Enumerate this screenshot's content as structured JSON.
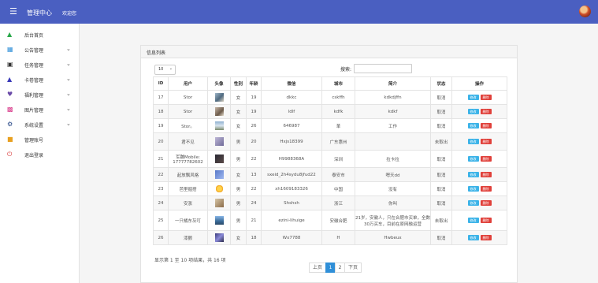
{
  "header": {
    "app_title": "管理中心",
    "welcome": "欢迎您"
  },
  "sidebar": {
    "items": [
      {
        "label": "后台首页",
        "icon": "home-icon",
        "expandable": false
      },
      {
        "label": "公告管理",
        "icon": "notice-icon",
        "expandable": true
      },
      {
        "label": "任务管理",
        "icon": "task-icon",
        "expandable": true
      },
      {
        "label": "卡卷管理",
        "icon": "card-icon",
        "expandable": true
      },
      {
        "label": "福利管理",
        "icon": "heart-icon",
        "expandable": true
      },
      {
        "label": "图片管理",
        "icon": "image-icon",
        "expandable": true
      },
      {
        "label": "系统设置",
        "icon": "gear-icon",
        "expandable": true
      },
      {
        "label": "管理账号",
        "icon": "account-icon",
        "expandable": false
      },
      {
        "label": "退出登录",
        "icon": "power-icon",
        "expandable": false
      }
    ]
  },
  "panel": {
    "title": "信息列表"
  },
  "controls": {
    "page_size": "10",
    "search_label": "搜索:"
  },
  "table": {
    "columns": [
      "ID",
      "用户",
      "头像",
      "性别",
      "年龄",
      "微信",
      "城市",
      "简介",
      "状态",
      "操作"
    ],
    "rows": [
      {
        "id": "17",
        "user": "Stor",
        "gender": "女",
        "age": "19",
        "wechat": "dkkc",
        "city": "cskffh",
        "intro": "kdkdjffn",
        "status": "取消"
      },
      {
        "id": "18",
        "user": "Stor",
        "gender": "女",
        "age": "19",
        "wechat": "ldlf",
        "city": "kdfk",
        "intro": "kdkf",
        "status": "取消"
      },
      {
        "id": "19",
        "user": "Stor。",
        "gender": "女",
        "age": "26",
        "wechat": "646987",
        "city": "革",
        "intro": "工作",
        "status": "取消"
      },
      {
        "id": "20",
        "user": "君不见",
        "gender": "男",
        "age": "20",
        "wechat": "Hxjs18399",
        "city": "广东惠州",
        "intro": "",
        "status": "未取出"
      },
      {
        "id": "21",
        "user": "军蹦Mobile:\n17777782602",
        "gender": "男",
        "age": "22",
        "wechat": "H9988368A",
        "city": "深圳",
        "intro": "拉卡拉",
        "status": "取消"
      },
      {
        "id": "22",
        "user": "起放飘风格",
        "gender": "女",
        "age": "13",
        "wechat": "sxeid_2h4sydu8jfud22",
        "city": "泰安市",
        "intro": "嗯天dd",
        "status": "取消"
      },
      {
        "id": "23",
        "user": "芭里掘搭",
        "gender": "男",
        "age": "22",
        "wechat": "xh1609183326",
        "city": "中国",
        "intro": "没有",
        "status": "取消"
      },
      {
        "id": "24",
        "user": "安涨",
        "gender": "男",
        "age": "24",
        "wechat": "Shshsh",
        "city": "浙江",
        "intro": "你叫",
        "status": "取消"
      },
      {
        "id": "25",
        "user": "一只橘东灰叮",
        "gender": "男",
        "age": "21",
        "wechat": "ezini-lihuige",
        "city": "安徽合肥",
        "intro": "21岁，安徽人，只在合肥市买单，全数30万买车，目前在原网融运营",
        "status": "未取出"
      },
      {
        "id": "26",
        "user": "漆颤",
        "gender": "女",
        "age": "18",
        "wechat": "Wx7788",
        "city": "H",
        "intro": "Hwbeux",
        "status": "取消"
      }
    ],
    "edit_label": "修改",
    "delete_label": "删除"
  },
  "footer": {
    "summary": "显示第 1 至 10 项结果，共 16 项",
    "prev": "上页",
    "pages": [
      "1",
      "2"
    ],
    "next": "下页",
    "active_page": "1"
  },
  "colors": {
    "header_bg": "#4a5fc1",
    "edit_btn": "#3bb3e8",
    "delete_btn": "#e0403a",
    "active_page": "#2f8fd8"
  }
}
